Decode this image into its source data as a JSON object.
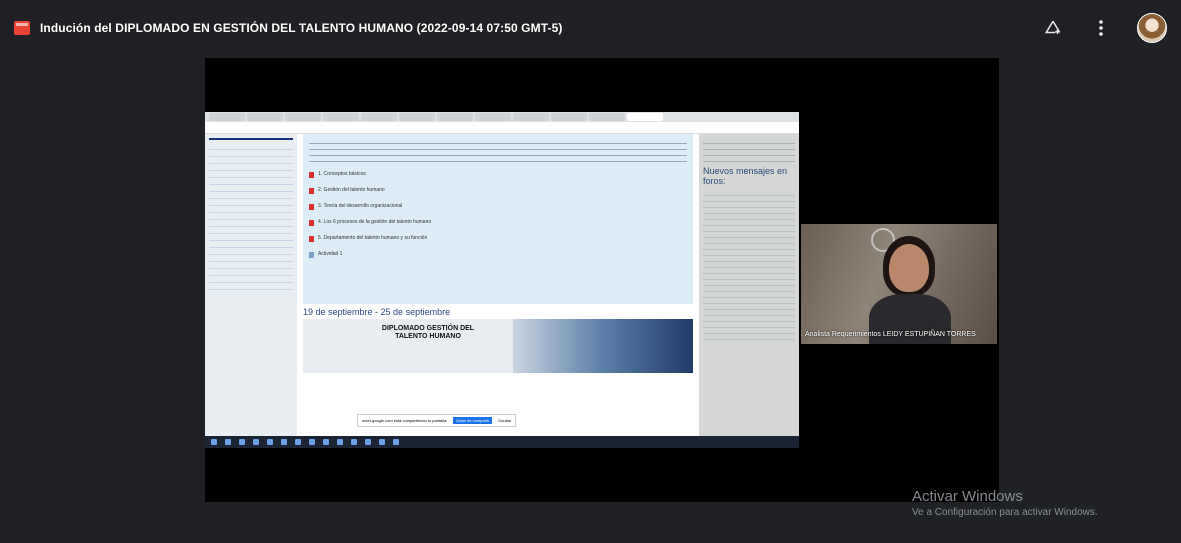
{
  "meeting": {
    "title": "Indución del DIPLOMADO EN GESTIÓN DEL TALENTO HUMANO (2022-09-14 07:50 GMT-5)"
  },
  "toolbar": {
    "add_icon": "add-to-drive-icon",
    "more_icon": "more-vert-icon",
    "avatar": "user-avatar"
  },
  "participant": {
    "name": "Analista Requerimientos LEIDY ESTUPIÑAN TORRES"
  },
  "shared": {
    "week_heading": "19 de septiembre - 25 de septiembre",
    "topics": [
      "1. Conceptos básicos",
      "2. Gestión del talento humano",
      "3. Teoría del desarrollo organizacional",
      "4. Los 6 procesos de la gestión del talento humano",
      "5. Departamento del talento humano y su función",
      "Actividad 1"
    ],
    "banner_title": "DIPLOMADO GESTIÓN DEL TALENTO HUMANO",
    "right_heading": "Nuevos mensajes en foros:",
    "share_text": "meet.google.com está compartiendo tu pantalla.",
    "share_stop": "Dejar de compartir",
    "share_hide": "Ocultar"
  },
  "watermark": {
    "title": "Activar Windows",
    "subtitle": "Ve a Configuración para activar Windows."
  },
  "colors": {
    "background": "#202124",
    "record": "#ea4335",
    "share_button": "#1a73e8"
  }
}
